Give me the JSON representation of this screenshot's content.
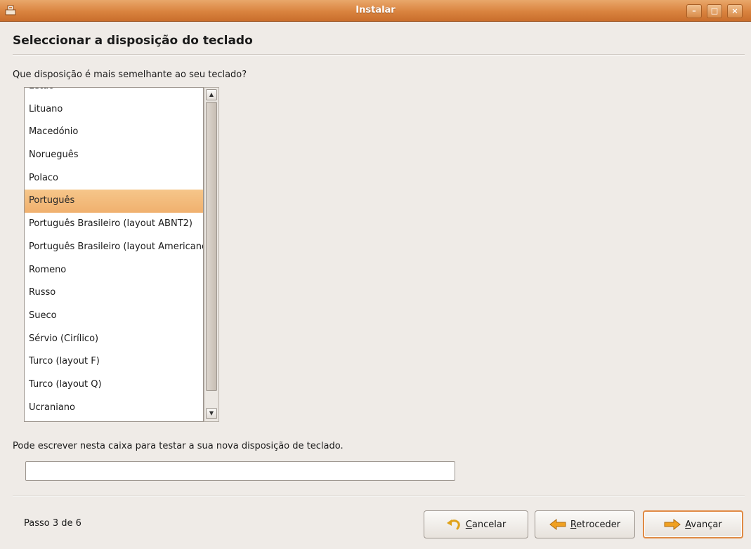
{
  "window": {
    "title": "Instalar",
    "controls": [
      "minimize-icon",
      "maximize-icon",
      "close-icon"
    ]
  },
  "page": {
    "heading": "Seleccionar a disposição do teclado",
    "question": "Que disposição é mais semelhante ao seu teclado?",
    "test_prompt": "Pode escrever nesta caixa para testar a sua nova disposição de teclado.",
    "test_input": {
      "value": "",
      "placeholder": ""
    }
  },
  "layout_list": {
    "items": [
      "Letão",
      "Lituano",
      "Macedónio",
      "Norueguês",
      "Polaco",
      "Português",
      "Português Brasileiro (layout ABNT2)",
      "Português Brasileiro (layout Americano)",
      "Romeno",
      "Russo",
      "Sueco",
      "Sérvio (Cirílico)",
      "Turco (layout F)",
      "Turco (layout Q)",
      "Ucraniano"
    ],
    "selected": "Português",
    "scroll_position": 0.45
  },
  "footer": {
    "step": "Passo 3 de 6",
    "buttons": {
      "cancel": {
        "mnemonic": "C",
        "rest": "ancelar"
      },
      "back": {
        "mnemonic": "R",
        "rest": "etroceder"
      },
      "forward": {
        "mnemonic": "A",
        "rest": "vançar"
      }
    }
  },
  "colors": {
    "titlebar": "#d9833f",
    "selection": "#f0b06e",
    "default_button_border": "#e08a44"
  }
}
